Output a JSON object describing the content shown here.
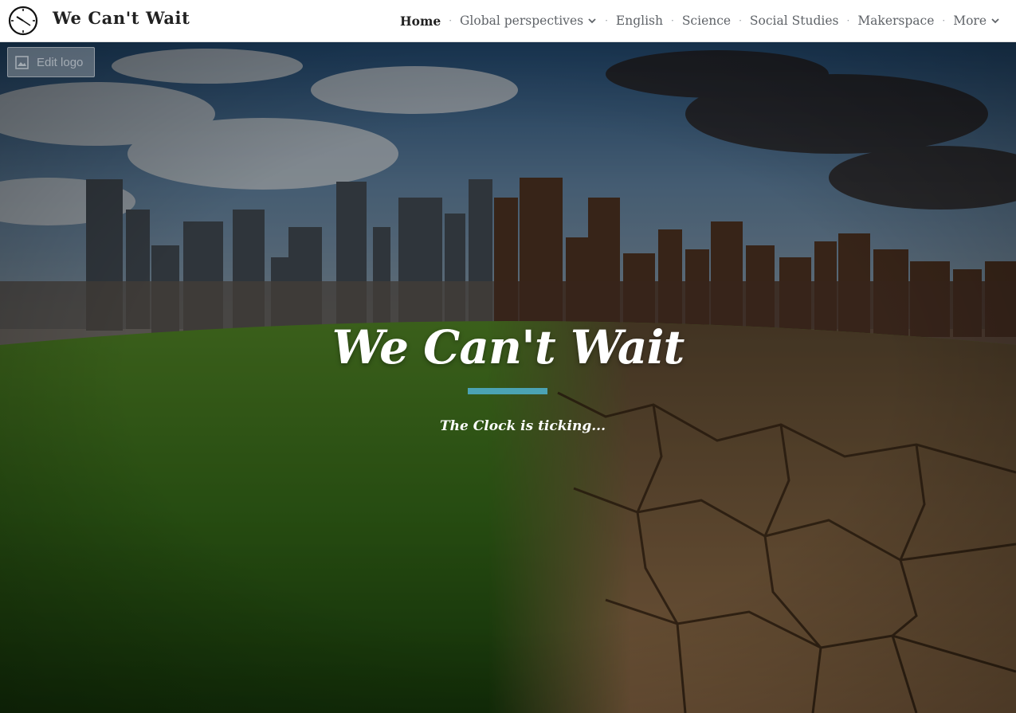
{
  "site": {
    "title": "We Can't Wait",
    "logo_icon": "clock-icon"
  },
  "nav": {
    "items": [
      {
        "label": "Home",
        "active": true
      },
      {
        "label": "Global perspectives",
        "has_dropdown": true
      },
      {
        "label": "English"
      },
      {
        "label": "Science"
      },
      {
        "label": "Social Studies"
      },
      {
        "label": "Makerspace"
      },
      {
        "label": "More",
        "has_dropdown": true
      }
    ]
  },
  "edit_logo": {
    "label": "Edit logo",
    "icon": "image-icon"
  },
  "hero": {
    "title": "We Can't Wait",
    "subtitle": "The Clock is ticking...",
    "accent_color": "#4ba3b4"
  },
  "colors": {
    "title_text": "#212121",
    "nav_text": "#5f6368"
  }
}
